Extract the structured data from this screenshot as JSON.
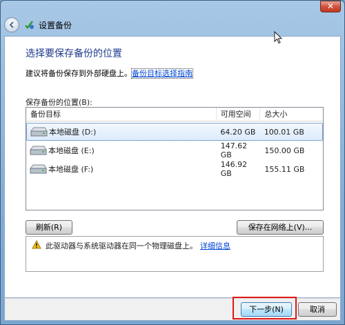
{
  "window": {
    "title": "设置备份",
    "close_label": "✕"
  },
  "page": {
    "heading": "选择要保存备份的位置",
    "desc_prefix": "建议将备份保存到外部硬盘上。",
    "desc_link": "备份目标选择指南",
    "list_label": "保存备份的位置(B):"
  },
  "table": {
    "columns": [
      "备份目标",
      "可用空间",
      "总大小"
    ],
    "rows": [
      {
        "name": "本地磁盘 (D:)",
        "free": "64.20 GB",
        "total": "100.01 GB",
        "selected": true
      },
      {
        "name": "本地磁盘 (E:)",
        "free": "147.62 GB",
        "total": "150.00 GB",
        "selected": false
      },
      {
        "name": "本地磁盘 (F:)",
        "free": "146.92 GB",
        "total": "155.11 GB",
        "selected": false
      }
    ]
  },
  "buttons": {
    "refresh": "刷新(R)",
    "save_network": "保存在网络上(V)...",
    "next": "下一步(N)",
    "cancel": "取消"
  },
  "warning": {
    "text": "此驱动器与系统驱动器在同一个物理磁盘上。",
    "link": "详细信息"
  },
  "colors": {
    "heading": "#1e3a8c",
    "link": "#0046d5",
    "highlight": "#e01616"
  }
}
